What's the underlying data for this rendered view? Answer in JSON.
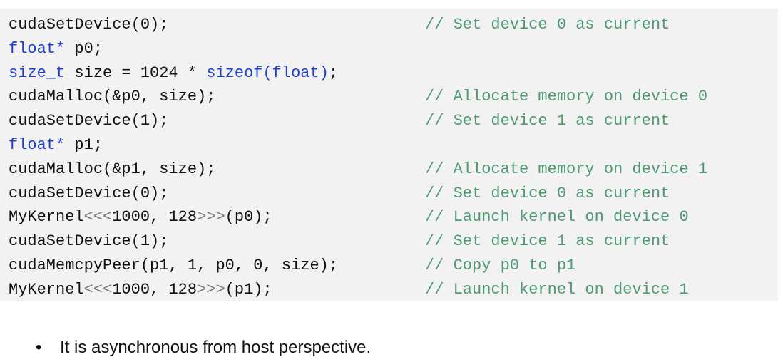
{
  "code_block": {
    "lines": [
      {
        "segments": [
          {
            "text": "cudaSetDevice(0);",
            "kind": "plain"
          }
        ],
        "comment": "// Set device 0 as current"
      },
      {
        "segments": [
          {
            "text": "float*",
            "kind": "kw"
          },
          {
            "text": " p0;",
            "kind": "plain"
          }
        ],
        "comment": ""
      },
      {
        "segments": [
          {
            "text": "size_t",
            "kind": "kw"
          },
          {
            "text": " size = 1024 * ",
            "kind": "plain"
          },
          {
            "text": "sizeof(float)",
            "kind": "kw"
          },
          {
            "text": ";",
            "kind": "plain"
          }
        ],
        "comment": ""
      },
      {
        "segments": [
          {
            "text": "cudaMalloc(&p0, size);",
            "kind": "plain"
          }
        ],
        "comment": "// Allocate memory on device 0"
      },
      {
        "segments": [
          {
            "text": "cudaSetDevice(1);",
            "kind": "plain"
          }
        ],
        "comment": "// Set device 1 as current"
      },
      {
        "segments": [
          {
            "text": "float*",
            "kind": "kw"
          },
          {
            "text": " p1;",
            "kind": "plain"
          }
        ],
        "comment": ""
      },
      {
        "segments": [
          {
            "text": "cudaMalloc(&p1, size);",
            "kind": "plain"
          }
        ],
        "comment": "// Allocate memory on device 1"
      },
      {
        "segments": [
          {
            "text": "cudaSetDevice(0);",
            "kind": "plain"
          }
        ],
        "comment": "// Set device 0 as current"
      },
      {
        "segments": [
          {
            "text": "MyKernel",
            "kind": "plain"
          },
          {
            "text": "<<<",
            "kind": "op"
          },
          {
            "text": "1000, 128",
            "kind": "plain"
          },
          {
            "text": ">>>",
            "kind": "op"
          },
          {
            "text": "(p0);",
            "kind": "plain"
          }
        ],
        "comment": "// Launch kernel on device 0"
      },
      {
        "segments": [
          {
            "text": "cudaSetDevice(1);",
            "kind": "plain"
          }
        ],
        "comment": "// Set device 1 as current"
      },
      {
        "segments": [
          {
            "text": "cudaMemcpyPeer(p1, 1, p0, 0, size);",
            "kind": "plain"
          }
        ],
        "comment": "// Copy p0 to p1"
      },
      {
        "segments": [
          {
            "text": "MyKernel",
            "kind": "plain"
          },
          {
            "text": "<<<",
            "kind": "op"
          },
          {
            "text": "1000, 128",
            "kind": "plain"
          },
          {
            "text": ">>>",
            "kind": "op"
          },
          {
            "text": "(p1);",
            "kind": "plain"
          }
        ],
        "comment": "// Launch kernel on device 1"
      }
    ]
  },
  "bullets": [
    {
      "marker": "•",
      "text": "It is asynchronous from host perspective."
    }
  ],
  "colors": {
    "code_background": "#f2f2f2",
    "keyword": "#1f3fc9",
    "comment": "#4f9a73",
    "operator": "#7a7a7a",
    "text": "#111111"
  }
}
